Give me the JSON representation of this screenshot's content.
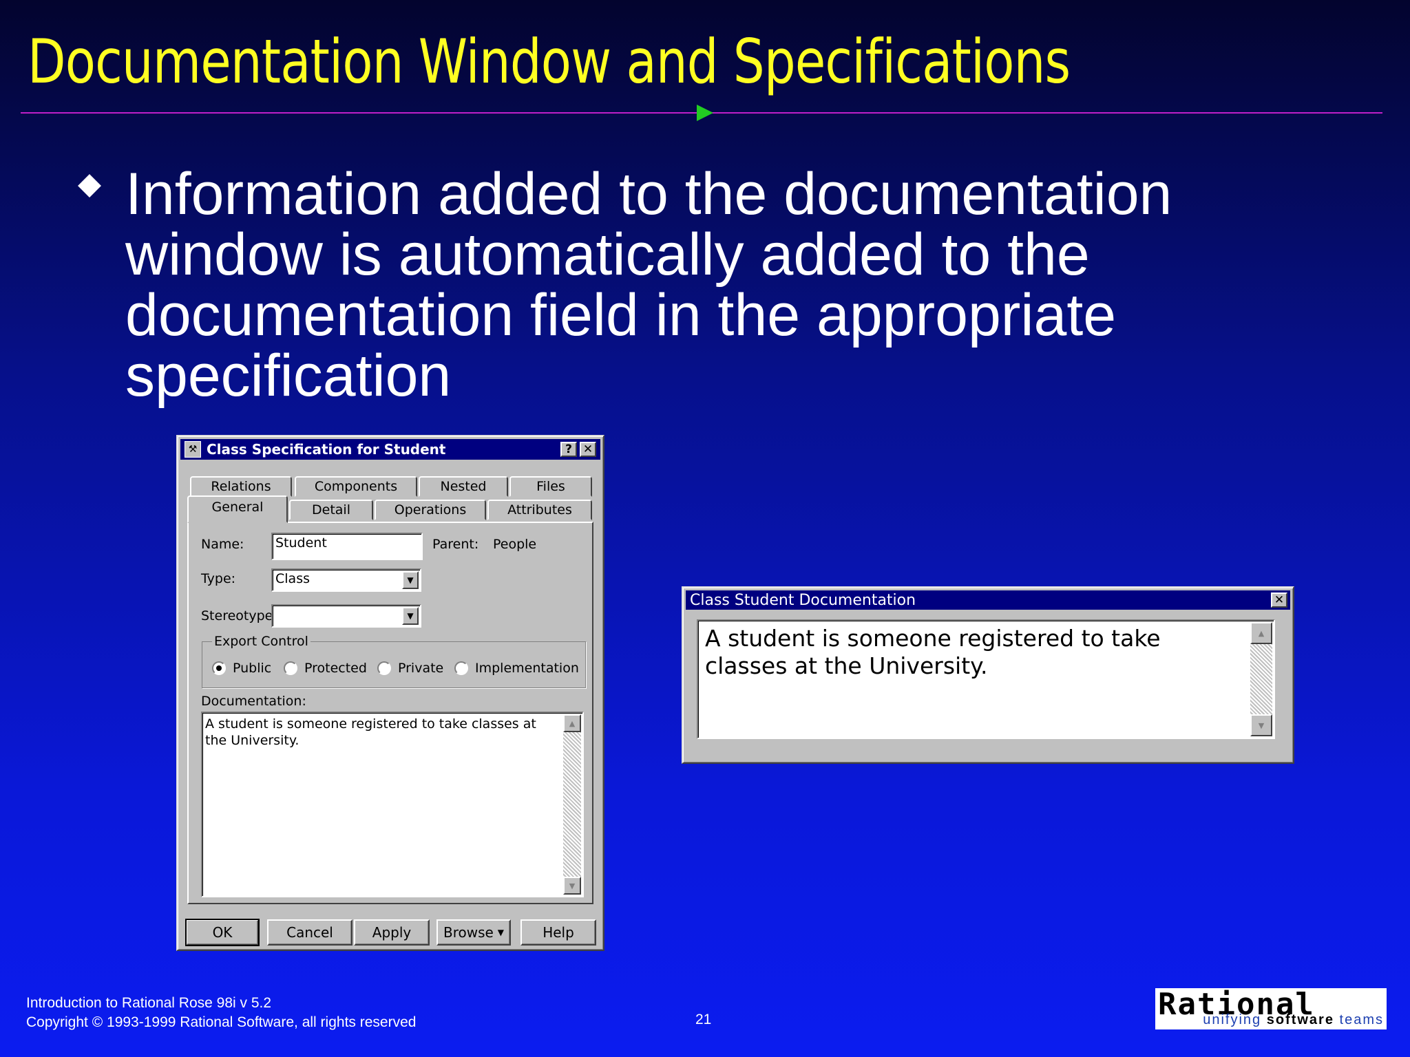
{
  "slide": {
    "title": "Documentation Window and Specifications",
    "bullet": "Information added to the documentation window is automatically added to the documentation field in the appropriate specification"
  },
  "spec_dialog": {
    "title": "Class Specification for Student",
    "help_btn": "?",
    "close_btn": "✕",
    "tabs_back": [
      "Relations",
      "Components",
      "Nested",
      "Files"
    ],
    "tabs_front": [
      "General",
      "Detail",
      "Operations",
      "Attributes"
    ],
    "active_tab": "General",
    "name_label": "Name:",
    "name_value": "Student",
    "parent_label": "Parent:",
    "parent_value": "People",
    "type_label": "Type:",
    "type_value": "Class",
    "stereotype_label": "Stereotype:",
    "stereotype_value": "",
    "export_control_label": "Export Control",
    "export_options": [
      "Public",
      "Protected",
      "Private",
      "Implementation"
    ],
    "export_selected": "Public",
    "documentation_label": "Documentation:",
    "documentation_text": "A student is someone registered to take classes at the University.",
    "buttons": [
      "OK",
      "Cancel",
      "Apply",
      "Browse",
      "Help"
    ]
  },
  "doc_window": {
    "title": "Class Student Documentation",
    "close_btn": "✕",
    "text": "A student is someone registered to take classes at the University."
  },
  "footer": {
    "line1": "Introduction to Rational Rose 98i  v 5.2",
    "line2": "Copyright © 1993-1999 Rational Software, all rights reserved",
    "page": "21"
  },
  "logo": {
    "main": "Rational",
    "tagline_part1": "unifying ",
    "tagline_part2": "software",
    "tagline_part3": " teams"
  },
  "colors": {
    "title": "#ffff22",
    "rule": "#c01fc8",
    "rule_arrow": "#22cc22",
    "titlebar": "#000080"
  }
}
